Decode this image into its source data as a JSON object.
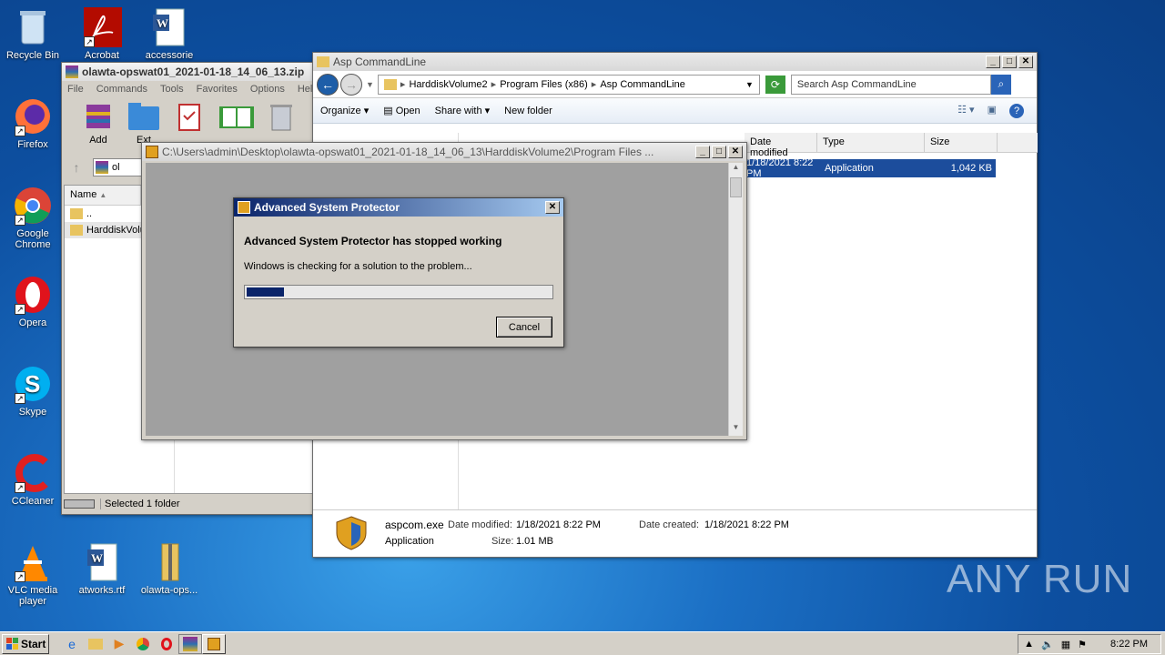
{
  "desktop_icons": [
    {
      "label": "Recycle Bin"
    },
    {
      "label": "Acrobat"
    },
    {
      "label": "accessorie"
    },
    {
      "label": "Firefox"
    },
    {
      "label": "Google Chrome"
    },
    {
      "label": "Opera"
    },
    {
      "label": "Skype"
    },
    {
      "label": "CCleaner"
    },
    {
      "label": "VLC media player"
    },
    {
      "label": "atworks.rtf"
    },
    {
      "label": "olawta-ops..."
    }
  ],
  "winrar": {
    "title": "olawta-opswat01_2021-01-18_14_06_13.zip",
    "menu": [
      "File",
      "Commands",
      "Tools",
      "Favorites",
      "Options",
      "Help"
    ],
    "toolbar": [
      "Add",
      "Ext"
    ],
    "addr_short": "ol",
    "col_name": "Name",
    "rows": [
      "..",
      "HarddiskVolu"
    ],
    "status": "Selected 1 folder"
  },
  "explorer": {
    "title": "Asp CommandLine",
    "breadcrumb": [
      "HarddiskVolume2",
      "Program Files (x86)",
      "Asp CommandLine"
    ],
    "search_placeholder": "Search Asp CommandLine",
    "commands": [
      "Organize",
      "Open",
      "Share with",
      "New folder"
    ],
    "columns": [
      "Date modified",
      "Type",
      "Size"
    ],
    "file_row": {
      "date": "1/18/2021 8:22 PM",
      "type": "Application",
      "size": "1,042 KB"
    },
    "details": {
      "name": "aspcom.exe",
      "date_modified_label": "Date modified:",
      "date_modified": "1/18/2021 8:22 PM",
      "date_created_label": "Date created:",
      "date_created": "1/18/2021 8:22 PM",
      "type": "Application",
      "size_label": "Size:",
      "size": "1.01 MB"
    }
  },
  "console": {
    "title": "C:\\Users\\admin\\Desktop\\olawta-opswat01_2021-01-18_14_06_13\\HarddiskVolume2\\Program Files ..."
  },
  "dialog": {
    "title": "Advanced System Protector",
    "heading": "Advanced System Protector has stopped working",
    "message": "Windows is checking for a solution to the problem...",
    "progress": 0.12,
    "cancel_label": "Cancel"
  },
  "taskbar": {
    "start_label": "Start",
    "clock": "8:22 PM"
  },
  "watermark": "ANY RUN"
}
